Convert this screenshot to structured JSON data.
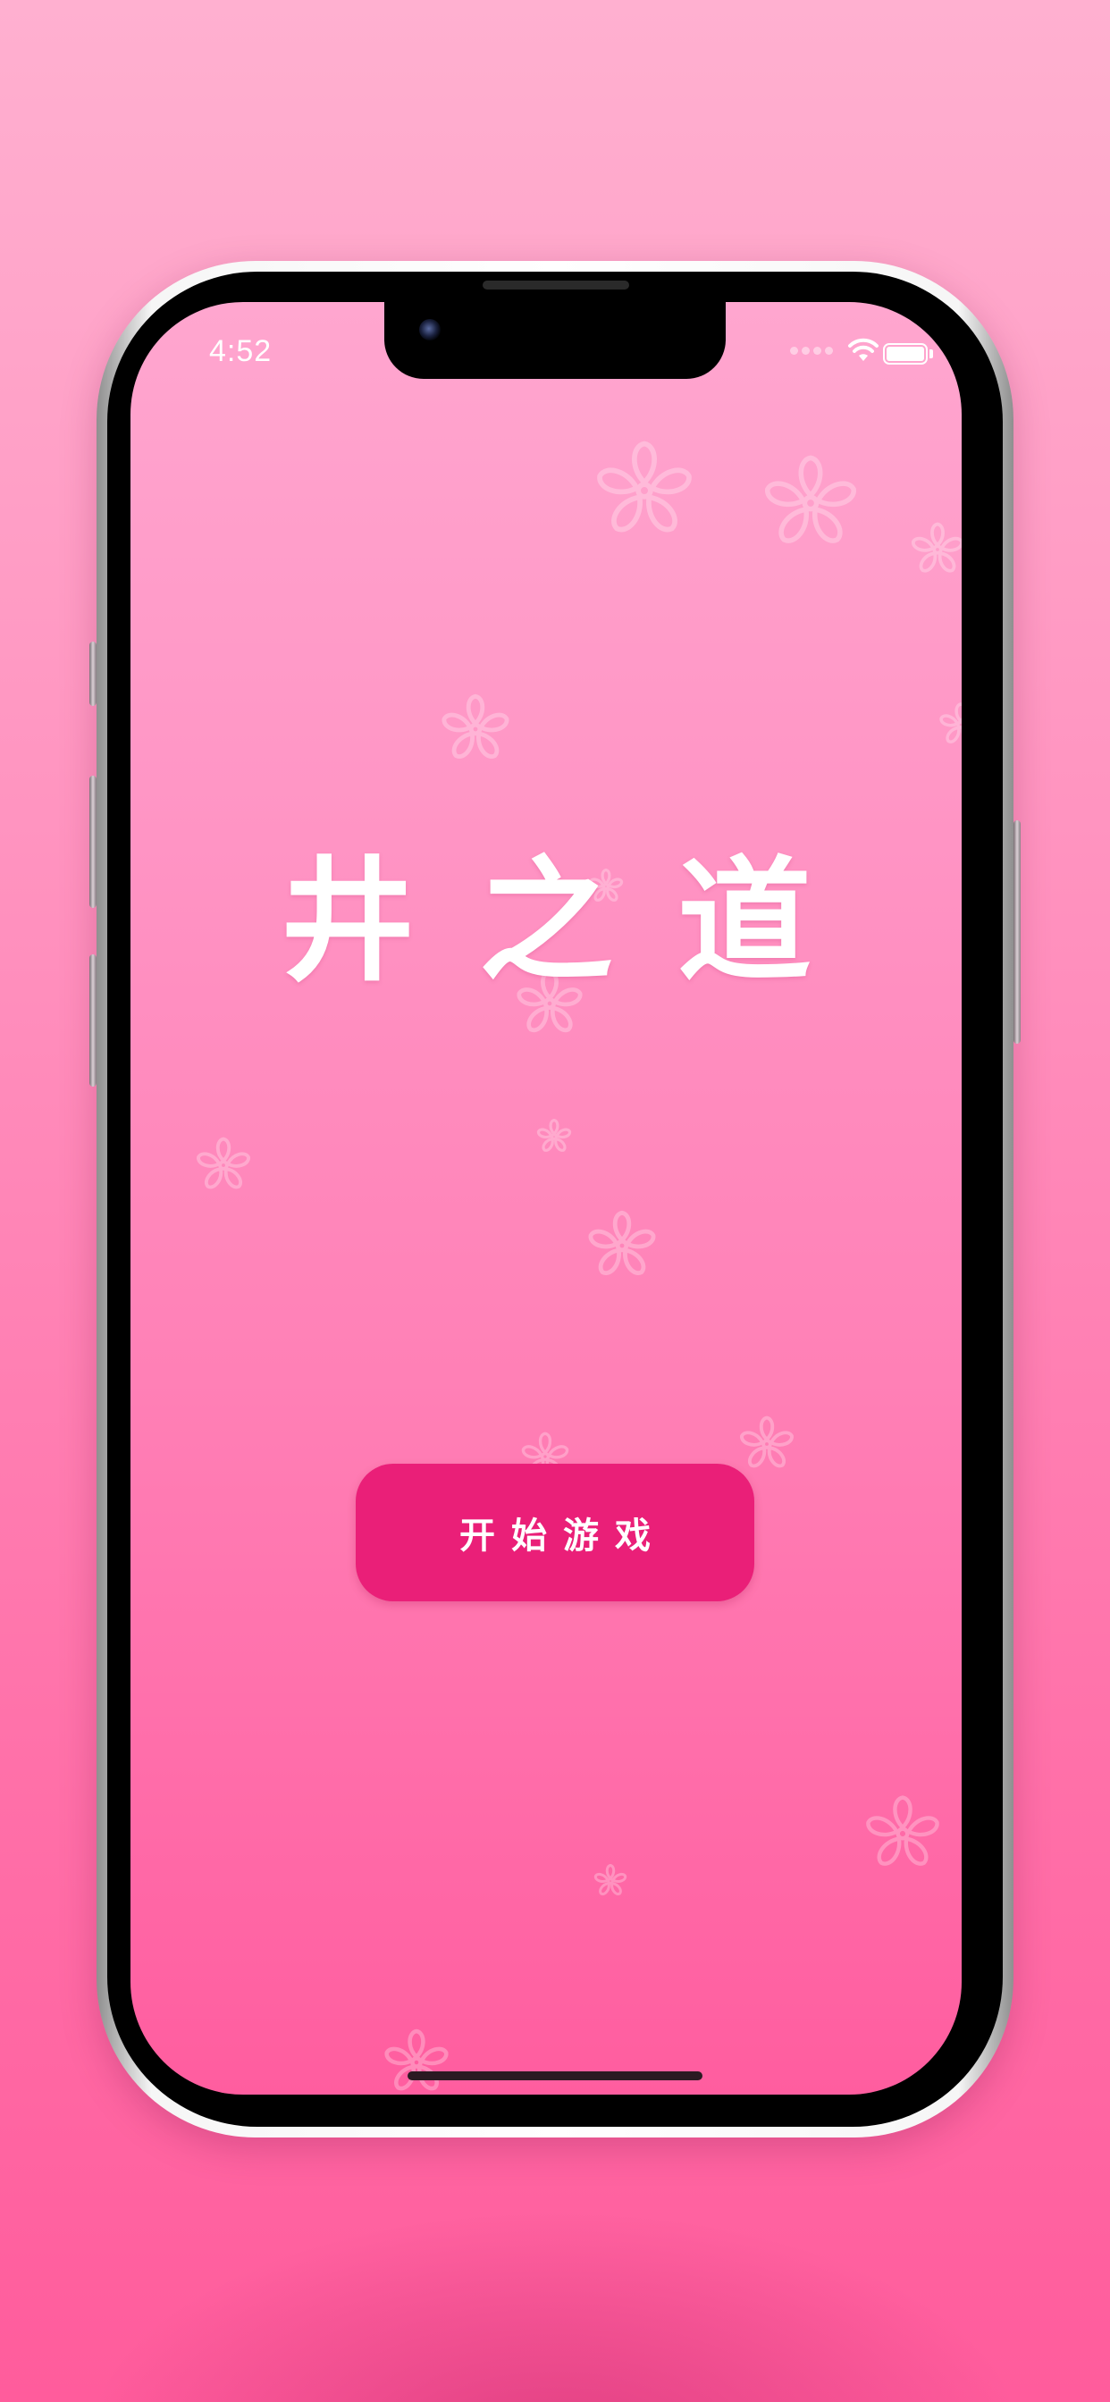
{
  "status_bar": {
    "time": "4:52",
    "wifi_icon": "wifi-icon",
    "battery_icon": "battery-icon"
  },
  "app": {
    "title": "井之道",
    "start_button_label": "开始游戏"
  },
  "decorations": {
    "blossom_icon": "cherry-blossom-icon",
    "blossom_color": "#ffffff"
  },
  "colors": {
    "background_top": "#ffb0d0",
    "background_bottom": "#ff5c9c",
    "button": "#ea1f78",
    "text": "#ffffff"
  }
}
